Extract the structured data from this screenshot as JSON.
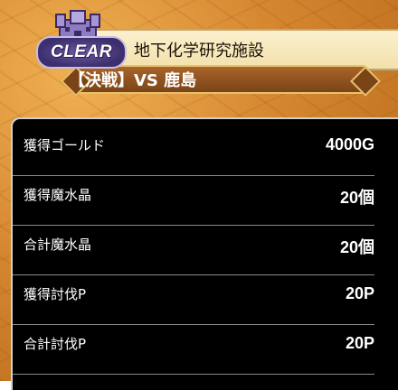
{
  "stage": {
    "title": "地下化学研究施設",
    "battle": "【決戦】VS 鹿島",
    "clear_badge": "CLEAR",
    "emblem_icon": "castle-icon"
  },
  "results": [
    {
      "label": "獲得ゴールド",
      "value": "4000G"
    },
    {
      "label": "獲得魔水晶",
      "value": "20個"
    },
    {
      "label": "合計魔水晶",
      "value": "20個"
    },
    {
      "label": "獲得討伐P",
      "value": "20P"
    },
    {
      "label": "合計討伐P",
      "value": "20P"
    }
  ],
  "colors": {
    "panel_bg": "#000000",
    "battle_bar": "#7a4417",
    "parchment": "#f3e0ab",
    "clear_badge": "#3d2f6e"
  }
}
